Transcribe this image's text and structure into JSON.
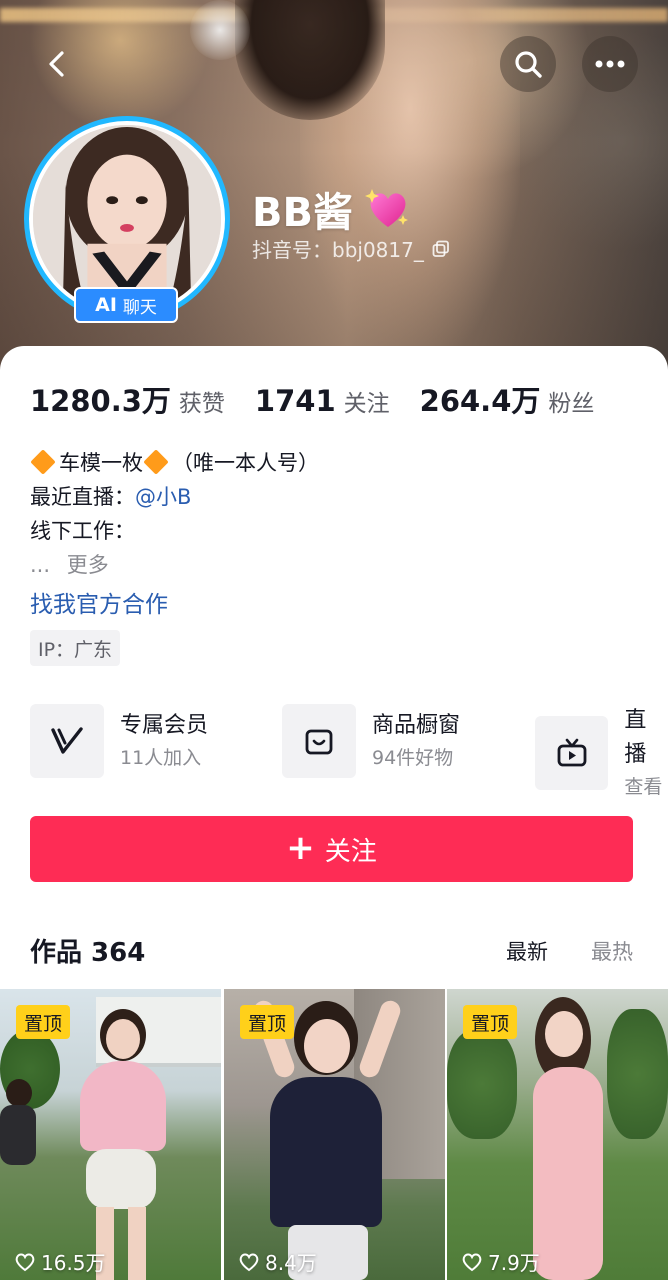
{
  "header": {
    "name": "BB酱",
    "douyin_id": "抖音号：bbj0817_",
    "ai_badge": {
      "ai": "AI",
      "label": "聊天"
    },
    "icons": [
      "back-icon",
      "search-icon",
      "more-icon",
      "copy-icon",
      "sparkle-heart-icon"
    ]
  },
  "stats": [
    {
      "num": "1280.3万",
      "label": "获赞"
    },
    {
      "num": "1741",
      "label": "关注"
    },
    {
      "num": "264.4万",
      "label": "粉丝"
    }
  ],
  "bio": {
    "line1": "车模一枚",
    "line1_tail": "（唯一本人号）",
    "line2_label": "最近直播：",
    "line2_mention": "@小B",
    "line3": "线下工作：",
    "more_dots": "...",
    "more": "更多",
    "official_link": "找我官方合作",
    "ip": "IP：广东"
  },
  "services": [
    {
      "title": "专属会员",
      "sub": "11人加入",
      "icon": "membership-v-icon"
    },
    {
      "title": "商品橱窗",
      "sub": "94件好物",
      "icon": "shop-window-icon"
    },
    {
      "title": "直播",
      "sub": "查看",
      "icon": "live-tv-icon"
    }
  ],
  "follow_button": "关注",
  "works": {
    "title": "作品 364",
    "sort_new": "最新",
    "sort_hot": "最热",
    "videos": [
      {
        "pin": "置顶",
        "likes": "16.5万"
      },
      {
        "pin": "置顶",
        "likes": "8.4万"
      },
      {
        "pin": "置顶",
        "likes": "7.9万"
      }
    ]
  },
  "colors": {
    "accent": "#fe2c55",
    "link": "#2a5db0",
    "ai_badge": "#2b8cff",
    "avatar_ring": "#21b8ff",
    "pin": "#ffd01a"
  }
}
